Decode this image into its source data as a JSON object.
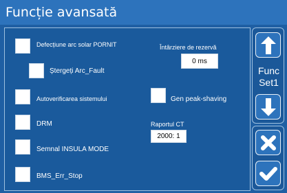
{
  "header": {
    "title": "Funcție avansată"
  },
  "options": {
    "arc_fault": "Defecțiune arc solar PORNIT",
    "clear_arc_fault": "Ștergeți Arc_Fault",
    "self_check": "Autoverificarea sistemului",
    "drm": "DRM",
    "island_mode": "Semnal INSULA MODE",
    "bms_err_stop": "BMS_Err_Stop",
    "peak_shaving": "Gen peak-shaving"
  },
  "backup_delay": {
    "label": "Întârziere de rezervă",
    "value": "0 ms"
  },
  "ct_ratio": {
    "label": "Raportul CT",
    "value": "2000: 1"
  },
  "side": {
    "func_line1": "Func",
    "func_line2": "Set1"
  }
}
